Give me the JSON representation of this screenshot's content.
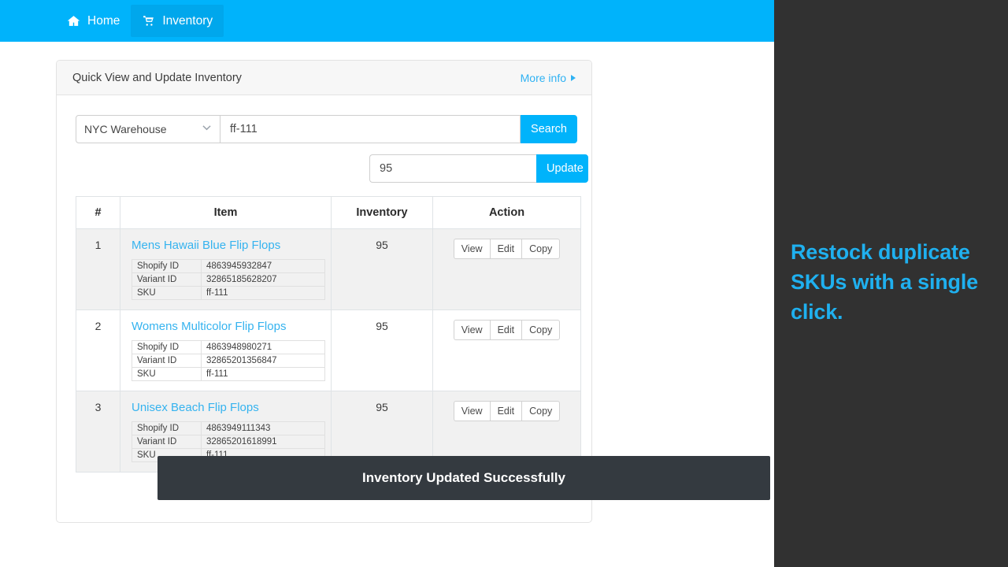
{
  "navbar": {
    "background": "#00b3fb",
    "items": [
      {
        "label": "Home",
        "icon": "home-icon",
        "active": false
      },
      {
        "label": "Inventory",
        "icon": "shopping-cart-icon",
        "active": true
      }
    ]
  },
  "card": {
    "header": {
      "title": "Quick View and Update Inventory",
      "more_info_label": "More info",
      "more_info_icon": "caret-right-icon"
    },
    "search": {
      "warehouse_selected": "NYC Warehouse",
      "warehouse_options": [
        "NYC Warehouse"
      ],
      "sku_value": "ff-111",
      "sku_placeholder": "",
      "search_button_label": "Search"
    },
    "update": {
      "quantity_value": "95",
      "quantity_placeholder": "",
      "update_button_label": "Update"
    },
    "table": {
      "columns": [
        "#",
        "Item",
        "Inventory",
        "Action"
      ],
      "detail_labels": {
        "shopify_id": "Shopify ID",
        "variant_id": "Variant ID",
        "sku": "SKU"
      },
      "action_labels": [
        "View",
        "Edit",
        "Copy"
      ],
      "rows": [
        {
          "num": "1",
          "item": "Mens Hawaii Blue Flip Flops",
          "shopify_id": "4863945932847",
          "variant_id": "32865185628207",
          "sku": "ff-111",
          "inventory": "95"
        },
        {
          "num": "2",
          "item": "Womens Multicolor Flip Flops",
          "shopify_id": "4863948980271",
          "variant_id": "32865201356847",
          "sku": "ff-111",
          "inventory": "95"
        },
        {
          "num": "3",
          "item": "Unisex Beach Flip Flops",
          "shopify_id": "4863949111343",
          "variant_id": "32865201618991",
          "sku": "ff-111",
          "inventory": "95"
        }
      ]
    }
  },
  "toast": {
    "message": "Inventory Updated Successfully",
    "background": "#343a40"
  },
  "promo": {
    "headline": "Restock duplicate SKUs with a single click.",
    "text_color": "#1fb0ef",
    "background": "#313131"
  },
  "colors": {
    "accent": "#00b3fb",
    "link": "#35b3ef",
    "dark_panel": "#313131",
    "stripe": "#f1f1f1"
  }
}
